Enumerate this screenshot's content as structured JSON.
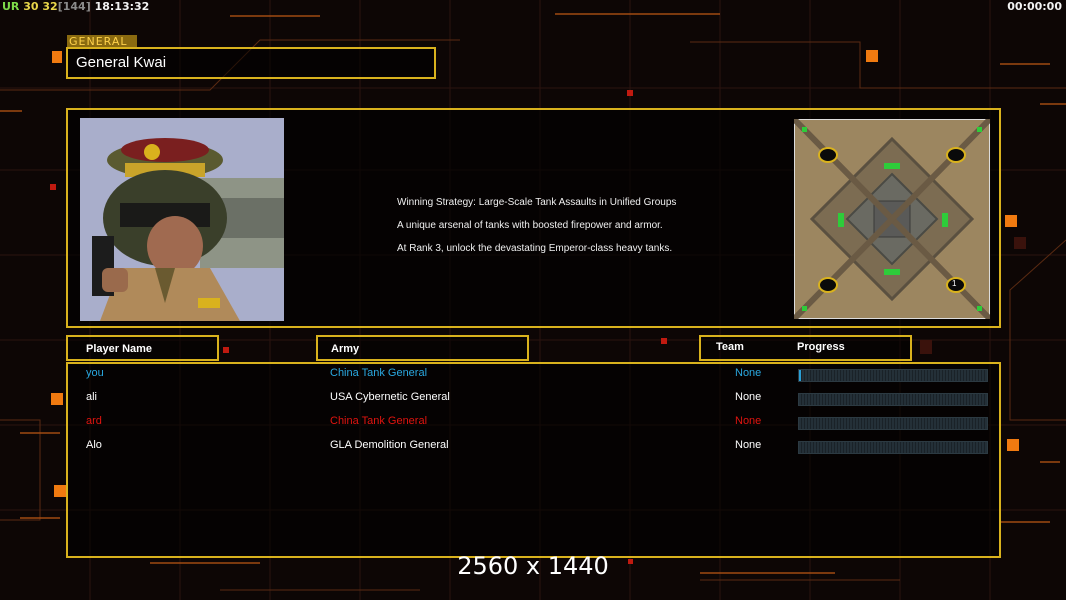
{
  "hud": {
    "ur": "UR",
    "num1": "30",
    "num2": "32",
    "num3": "[144]",
    "clock": "18:13:32",
    "timer": "00:00:00"
  },
  "general": {
    "tag": "GENERAL",
    "name": "General Kwai"
  },
  "strategy": [
    "Winning Strategy: Large-Scale Tank Assaults in Unified Groups",
    "A unique arsenal of tanks with boosted firepower and armor.",
    "At Rank 3, unlock the devastating Emperor-class heavy tanks."
  ],
  "minimap": {
    "player_marker": "1"
  },
  "table": {
    "headers": {
      "player": "Player Name",
      "army": "Army",
      "team": "Team",
      "progress": "Progress"
    },
    "rows": [
      {
        "name": "you",
        "army": "China Tank General",
        "team": "None",
        "progress": 0.01,
        "color": "#2aa8e0"
      },
      {
        "name": "ali",
        "army": "USA Cybernetic General",
        "team": "None",
        "progress": 0,
        "color": "#ffffff"
      },
      {
        "name": "ard",
        "army": "China Tank General",
        "team": "None",
        "progress": 0,
        "color": "#e0140f"
      },
      {
        "name": "Alo",
        "army": "GLA Demolition General",
        "team": "None",
        "progress": 0,
        "color": "#ffffff"
      }
    ]
  },
  "resolution": "2560 x 1440",
  "colors": {
    "gold": "#d9b21d",
    "accent_orange": "#f07a10"
  }
}
